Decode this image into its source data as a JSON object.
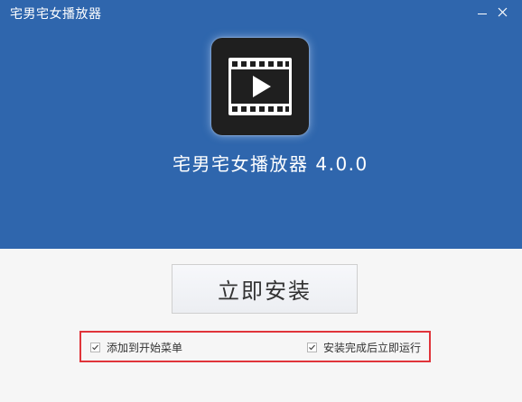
{
  "window": {
    "title": "宅男宅女播放器"
  },
  "hero": {
    "app_icon": "film-play-icon",
    "app_name": "宅男宅女播放器 4.0.0"
  },
  "actions": {
    "install_label": "立即安装"
  },
  "options": [
    {
      "label": "添加到开始菜单",
      "checked": true
    },
    {
      "label": "安装完成后立即运行",
      "checked": true
    }
  ],
  "colors": {
    "header_bg": "#2f66ad",
    "body_bg": "#f6f6f6",
    "highlight_border": "#e0343a"
  }
}
